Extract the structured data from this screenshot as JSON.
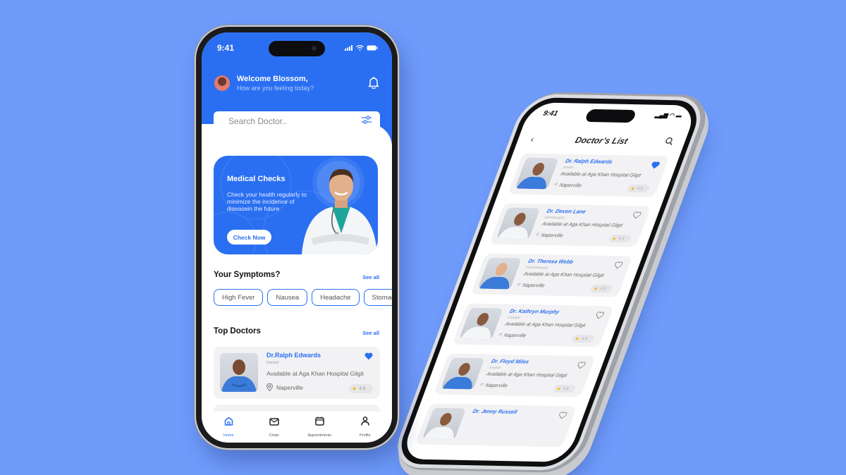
{
  "colors": {
    "background": "#6f9bfb",
    "brand": "#2a6ff2",
    "card": "#f2f2f4",
    "star": "#f5b50a"
  },
  "home": {
    "status": {
      "time": "9:41"
    },
    "header": {
      "title": "Welcome Blossom,",
      "subtitle": "How are you feeling today?",
      "bell_icon": "bell-icon",
      "avatar_icon": "user-avatar"
    },
    "search": {
      "placeholder": "Search Doctor..",
      "value": "",
      "filter_icon": "sliders-icon"
    },
    "promo": {
      "title": "Medical Checks",
      "text": "Check your health regularly to minimize the incidence of diseasein the future",
      "button": "Check Now"
    },
    "symptoms": {
      "title": "Your Symptoms?",
      "see_all": "See all",
      "chips": [
        "High Fever",
        "Nausea",
        "Headache",
        "Stomach"
      ]
    },
    "top_doctors": {
      "title": "Top Doctors",
      "see_all": "See all",
      "doctors": [
        {
          "name": "Dr.Ralph Edwards",
          "specialty": "Dentist",
          "availability": "Available at Aga Khan Hospital Gilgit",
          "location": "Naperville",
          "rating": "4.9",
          "favorite": true
        }
      ]
    },
    "tabbar": [
      {
        "label": "Home",
        "icon": "home-icon",
        "active": true
      },
      {
        "label": "Chats",
        "icon": "mail-icon",
        "active": false
      },
      {
        "label": "Appointments",
        "icon": "calendar-icon",
        "active": false
      },
      {
        "label": "Profile",
        "icon": "user-icon",
        "active": false
      }
    ]
  },
  "list": {
    "status": {
      "time": "9:41"
    },
    "title": "Doctor’s List",
    "doctors": [
      {
        "name": "Dr. Ralph Edwards",
        "specialty": "Dentist",
        "availability": "Available at Aga Khan Hospital Gilgit",
        "location": "Naperville",
        "rating": "4.9",
        "favorite": true
      },
      {
        "name": "Dr. Devon Lane",
        "specialty": "Dermatologist",
        "availability": "Available at Aga Khan Hospital Gilgit",
        "location": "Naperville",
        "rating": "4.9",
        "favorite": false
      },
      {
        "name": "Dr. Theresa Webb",
        "specialty": "Physiotherapist",
        "availability": "Available at Aga Khan Hospital Gilgit",
        "location": "Naperville",
        "rating": "4.9",
        "favorite": false
      },
      {
        "name": "Dr. Kathryn Murphy",
        "specialty": "Urologist",
        "availability": "Available at Aga Khan Hospital Gilgit",
        "location": "Naperville",
        "rating": "4.9",
        "favorite": false
      },
      {
        "name": "Dr. Floyd Miles",
        "specialty": "Surgeon",
        "availability": "Available at Aga Khan Hospital Gilgit",
        "location": "Naperville",
        "rating": "4.9",
        "favorite": false
      },
      {
        "name": "Dr. Jenny Russell",
        "specialty": "",
        "availability": "",
        "location": "",
        "rating": "",
        "favorite": false
      }
    ]
  }
}
